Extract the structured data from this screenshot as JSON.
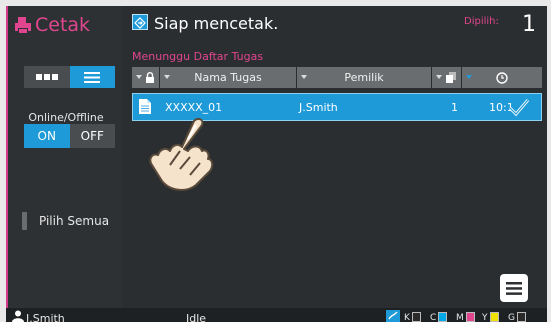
{
  "app": {
    "title": "Cetak"
  },
  "left_panel": {
    "online_label": "Online/Offline",
    "on_label": "ON",
    "off_label": "OFF",
    "select_all_label": "Pilih Semua"
  },
  "status": {
    "text": "Siap mencetak.",
    "selected_label": "Dipilih:",
    "selected_count": "1"
  },
  "queue": {
    "label": "Menunggu Daftar Tugas",
    "columns": [
      "Nama Tugas",
      "Pemilik"
    ],
    "rows": [
      {
        "name": "XXXXX_01",
        "owner": "J.Smith",
        "copies": "1",
        "time": "10:1"
      }
    ]
  },
  "bottom": {
    "user": "J.Smith",
    "job_status": "Idle",
    "toner_labels": [
      "K",
      "C",
      "M",
      "Y",
      "G"
    ]
  },
  "colors": {
    "accent_blue": "#1e9ad8",
    "accent_pink": "#e0468f",
    "toner_c": "#00a8e8",
    "toner_m": "#e0468f",
    "toner_y": "#f3e100"
  }
}
